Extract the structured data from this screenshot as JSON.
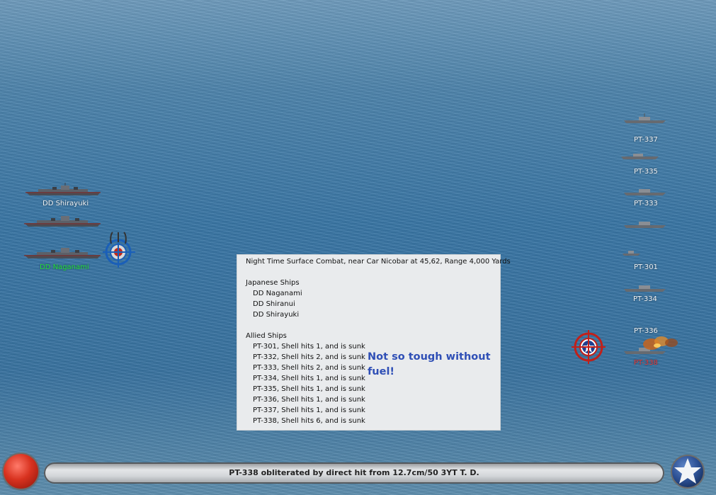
{
  "japanese_ships": [
    {
      "label": "DD Shirayuki",
      "state": "normal"
    },
    {
      "label": "",
      "state": "normal"
    },
    {
      "label": "DD Naganami",
      "state": "active"
    }
  ],
  "allied_ships": [
    {
      "label": "PT-337"
    },
    {
      "label": "PT-335"
    },
    {
      "label": "PT-333"
    },
    {
      "label": ""
    },
    {
      "label": ""
    },
    {
      "label": "PT-301"
    },
    {
      "label": "PT-334"
    },
    {
      "label": "PT-336"
    },
    {
      "label": "PT-338",
      "state": "hit"
    }
  ],
  "report": {
    "header": "Night Time Surface Combat, near Car Nicobar at 45,62, Range 4,000 Yards",
    "japanese_title": "Japanese Ships",
    "japanese_list": [
      "DD Naganami",
      "DD Shiranui",
      "DD Shirayuki"
    ],
    "allied_title": "Allied Ships",
    "allied_list": [
      "PT-301, Shell hits 1, and is sunk",
      "PT-332, Shell hits 2, and is sunk",
      "PT-333, Shell hits 2, and is sunk",
      "PT-334, Shell hits 1, and is sunk",
      "PT-335, Shell hits 1, and is sunk",
      "PT-336, Shell hits 1, and is sunk",
      "PT-337, Shell hits 1, and is sunk",
      "PT-338, Shell hits 6, and is sunk"
    ],
    "note": "Not so tough without fuel!"
  },
  "status_message": "PT-338 obliterated by direct hit from 12.7cm/50 3YT T. D.",
  "colors": {
    "active_label": "#22e03a",
    "hit_label": "#e43a3a",
    "note_text": "#2f4fb6"
  },
  "icons": {
    "japanese_target": "japanese-target-reticle-icon",
    "allied_target": "allied-star-target-icon",
    "fire": "explosion-fire-icon"
  }
}
